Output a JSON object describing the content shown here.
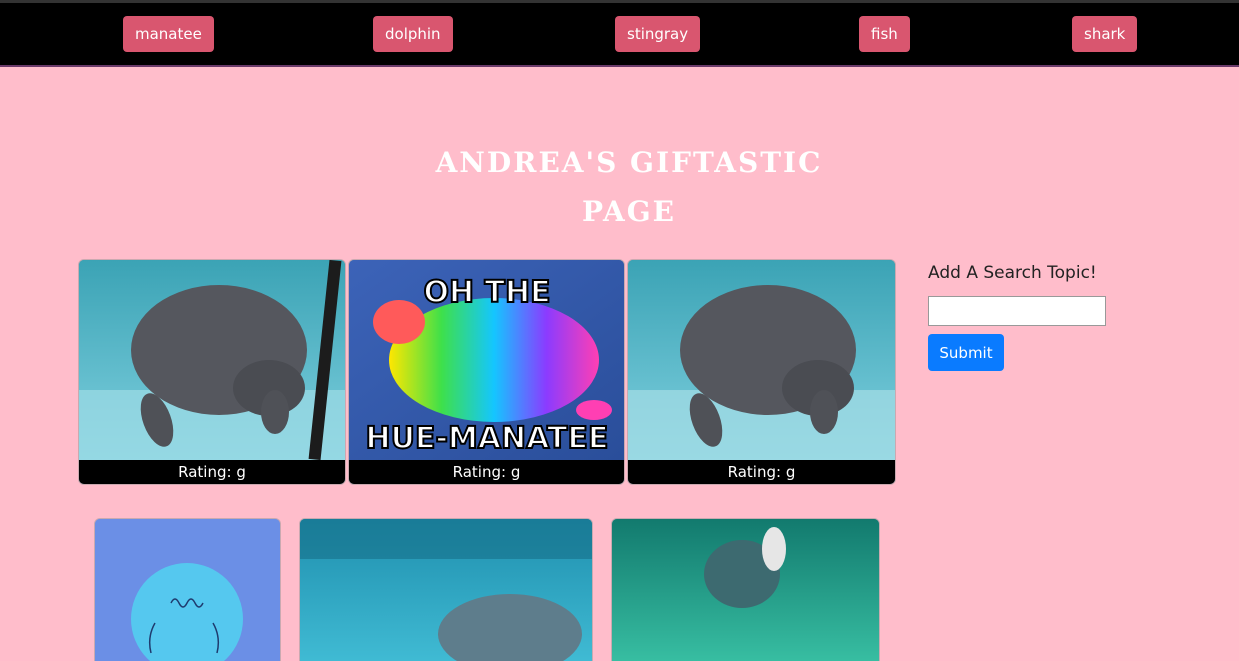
{
  "topics": [
    {
      "label": "manatee"
    },
    {
      "label": "dolphin"
    },
    {
      "label": "stingray"
    },
    {
      "label": "fish"
    },
    {
      "label": "shark"
    }
  ],
  "header": {
    "title_line1": "Andrea's Giftastic",
    "title_line2": "Page"
  },
  "gifs": [
    {
      "rating": "Rating: g",
      "caption_top": "",
      "caption_bottom": ""
    },
    {
      "rating": "Rating: g",
      "caption_top": "OH THE",
      "caption_bottom": "HUE-MANATEE"
    },
    {
      "rating": "Rating: g",
      "caption_top": "",
      "caption_bottom": ""
    }
  ],
  "sidebar": {
    "label": "Add A Search Topic!",
    "input_value": "",
    "submit_label": "Submit"
  },
  "colors": {
    "page_background": "#ffbdcb",
    "topic_button": "#d9566f",
    "submit_button": "#0a7bff"
  }
}
